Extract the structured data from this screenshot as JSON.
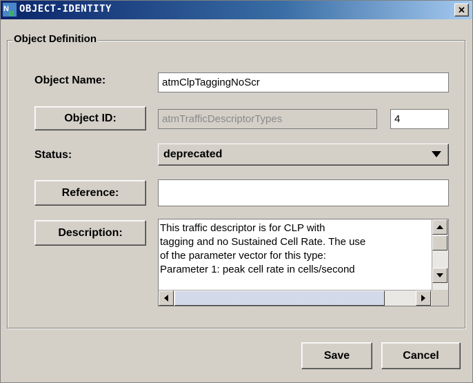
{
  "window": {
    "title": "OBJECT-IDENTITY",
    "close_glyph": "✕",
    "app_icon": "nb-logo-icon"
  },
  "group": {
    "title": "Object Definition"
  },
  "fields": {
    "object_name": {
      "label": "Object Name:",
      "value": "atmClpTaggingNoScr"
    },
    "object_id": {
      "label": "Object ID:",
      "value": "atmTrafficDescriptorTypes",
      "suffix": "4"
    },
    "status": {
      "label": "Status:",
      "value": "deprecated"
    },
    "reference": {
      "label": "Reference:",
      "value": ""
    },
    "description": {
      "label": "Description:",
      "lines": [
        "This traffic descriptor is for CLP with",
        "tagging and no Sustained Cell Rate.  The use",
        "of the parameter vector for this type:",
        "Parameter 1: peak cell rate in cells/second"
      ]
    }
  },
  "buttons": {
    "save": "Save",
    "cancel": "Cancel"
  },
  "colors": {
    "titlebar_start": "#0a246a",
    "titlebar_end": "#a6caf0",
    "window_bg": "#d4d0c8"
  }
}
